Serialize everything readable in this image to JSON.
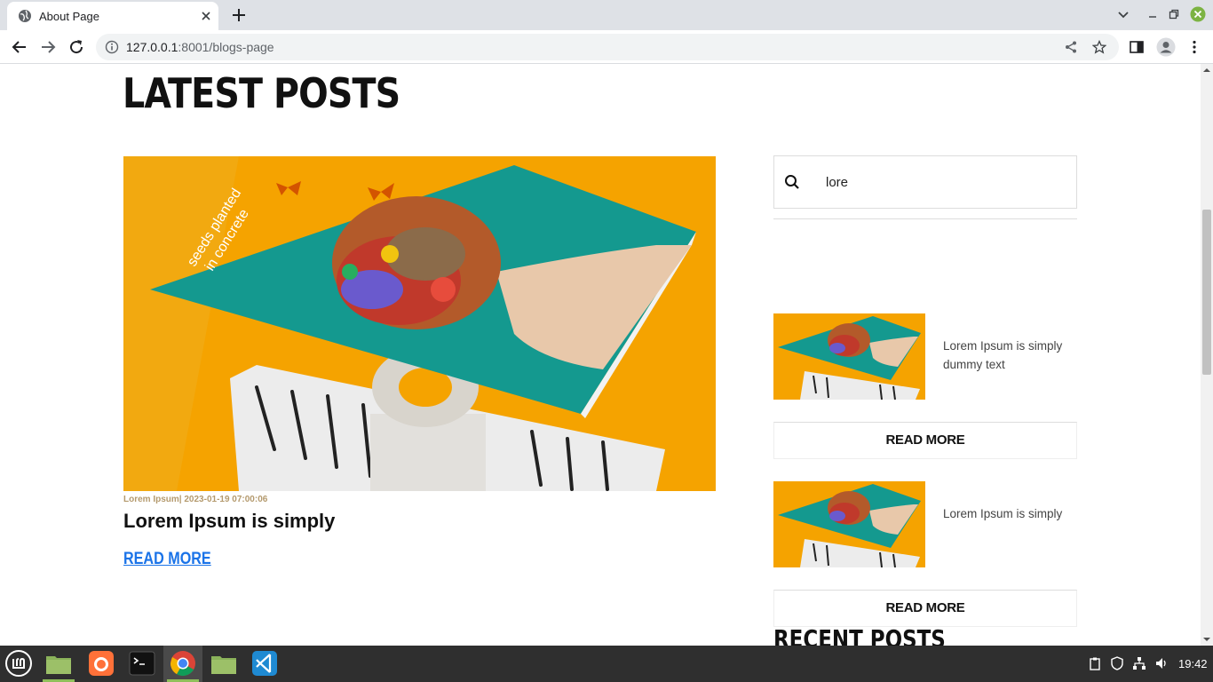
{
  "browser": {
    "tab_title": "About Page",
    "url_host": "127.0.0.1",
    "url_rest": ":8001/blogs-page"
  },
  "page": {
    "heading": "Latest Posts",
    "main_post": {
      "meta": "Lorem Ipsum| 2023-01-19 07:00:06",
      "title": "Lorem Ipsum is simply",
      "read_more": "Read More"
    },
    "search": {
      "value": "lore"
    },
    "side_posts": [
      {
        "text": "Lorem Ipsum is simply dummy text",
        "read_more": "Read More"
      },
      {
        "text": "Lorem Ipsum is simply",
        "read_more": "Read More"
      }
    ],
    "recent_heading": "Recent Posts"
  },
  "taskbar": {
    "clock": "19:42"
  }
}
